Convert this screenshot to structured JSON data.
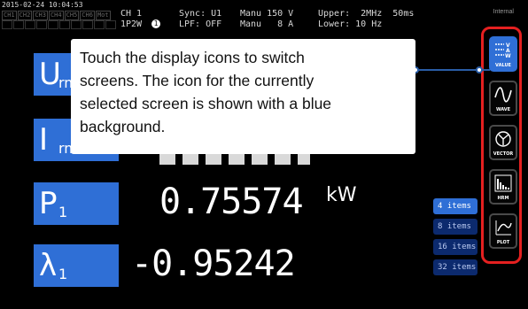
{
  "status_bar": {
    "datetime": "2015-02-24 10:04:53",
    "channel_boxes": [
      "CH1",
      "CH2",
      "CH3",
      "CH4",
      "CH5",
      "CH6",
      "Mot"
    ],
    "ch": "CH 1",
    "wiring": "1P2W",
    "wiring_badge": "1",
    "sync": "Sync: U1",
    "lpf": "LPF: OFF",
    "range_v": "Manu 150 V",
    "range_a": "Manu   8 A",
    "upper": "Upper:  2MHz  50ms",
    "lower": "Lower: 10 Hz",
    "internal": "Internal"
  },
  "rows": [
    {
      "symbol": "U",
      "subscript": "rms",
      "value": "",
      "unit": ""
    },
    {
      "symbol": "I",
      "subscript": "rms",
      "value": "",
      "unit": ""
    },
    {
      "symbol": "P",
      "subscript": "1",
      "value": "0.75574",
      "unit": "kW"
    },
    {
      "symbol": "λ",
      "subscript": "1",
      "value": "-0.95242",
      "unit": ""
    }
  ],
  "item_buttons": [
    {
      "label": "4 items",
      "active": true
    },
    {
      "label": "8 items",
      "active": false
    },
    {
      "label": "16 items",
      "active": false
    },
    {
      "label": "32 items",
      "active": false
    }
  ],
  "display_icons": [
    {
      "label": "VALUE",
      "icon": "value-icon",
      "selected": true
    },
    {
      "label": "WAVE",
      "icon": "wave-icon",
      "selected": false
    },
    {
      "label": "VECTOR",
      "icon": "vector-icon",
      "selected": false
    },
    {
      "label": "HRM",
      "icon": "hrm-icon",
      "selected": false
    },
    {
      "label": "PLOT",
      "icon": "plot-icon",
      "selected": false
    }
  ],
  "callout": {
    "line1": "Touch the display icons to switch",
    "line2": "screens. The icon for the currently",
    "line3": "selected screen is shown with a blue",
    "line4": "background."
  },
  "colors": {
    "accent_blue": "#2f6fd6",
    "highlight_red": "#e52020",
    "background": "#000000"
  }
}
